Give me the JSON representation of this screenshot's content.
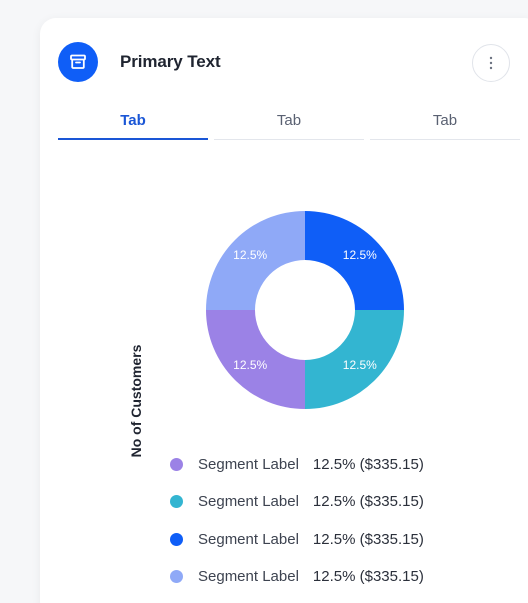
{
  "header": {
    "title": "Primary Text",
    "icon": "archive-icon",
    "menu_icon": "more-vertical-icon",
    "accent_color": "#0f5ef7"
  },
  "tabs": [
    {
      "label": "Tab",
      "active": true
    },
    {
      "label": "Tab",
      "active": false
    },
    {
      "label": "Tab",
      "active": false
    }
  ],
  "chart_data": {
    "type": "pie",
    "variant": "donut",
    "ylabel": "No of Customers",
    "slices": [
      {
        "label": "12.5%",
        "value": 12.5,
        "color": "#0f5ef7"
      },
      {
        "label": "12.5%",
        "value": 12.5,
        "color": "#33b5d1"
      },
      {
        "label": "12.5%",
        "value": 12.5,
        "color": "#9b82e6"
      },
      {
        "label": "12.5%",
        "value": 12.5,
        "color": "#8fa9f7"
      }
    ],
    "legend": [
      {
        "label": "Segment Label",
        "value": "12.5% ($335.15)",
        "color": "#9b82e6"
      },
      {
        "label": "Segment Label",
        "value": "12.5% ($335.15)",
        "color": "#33b5d1"
      },
      {
        "label": "Segment Label",
        "value": "12.5% ($335.15)",
        "color": "#0f5ef7"
      },
      {
        "label": "Segment Label",
        "value": "12.5% ($335.15)",
        "color": "#8fa9f7"
      }
    ]
  }
}
